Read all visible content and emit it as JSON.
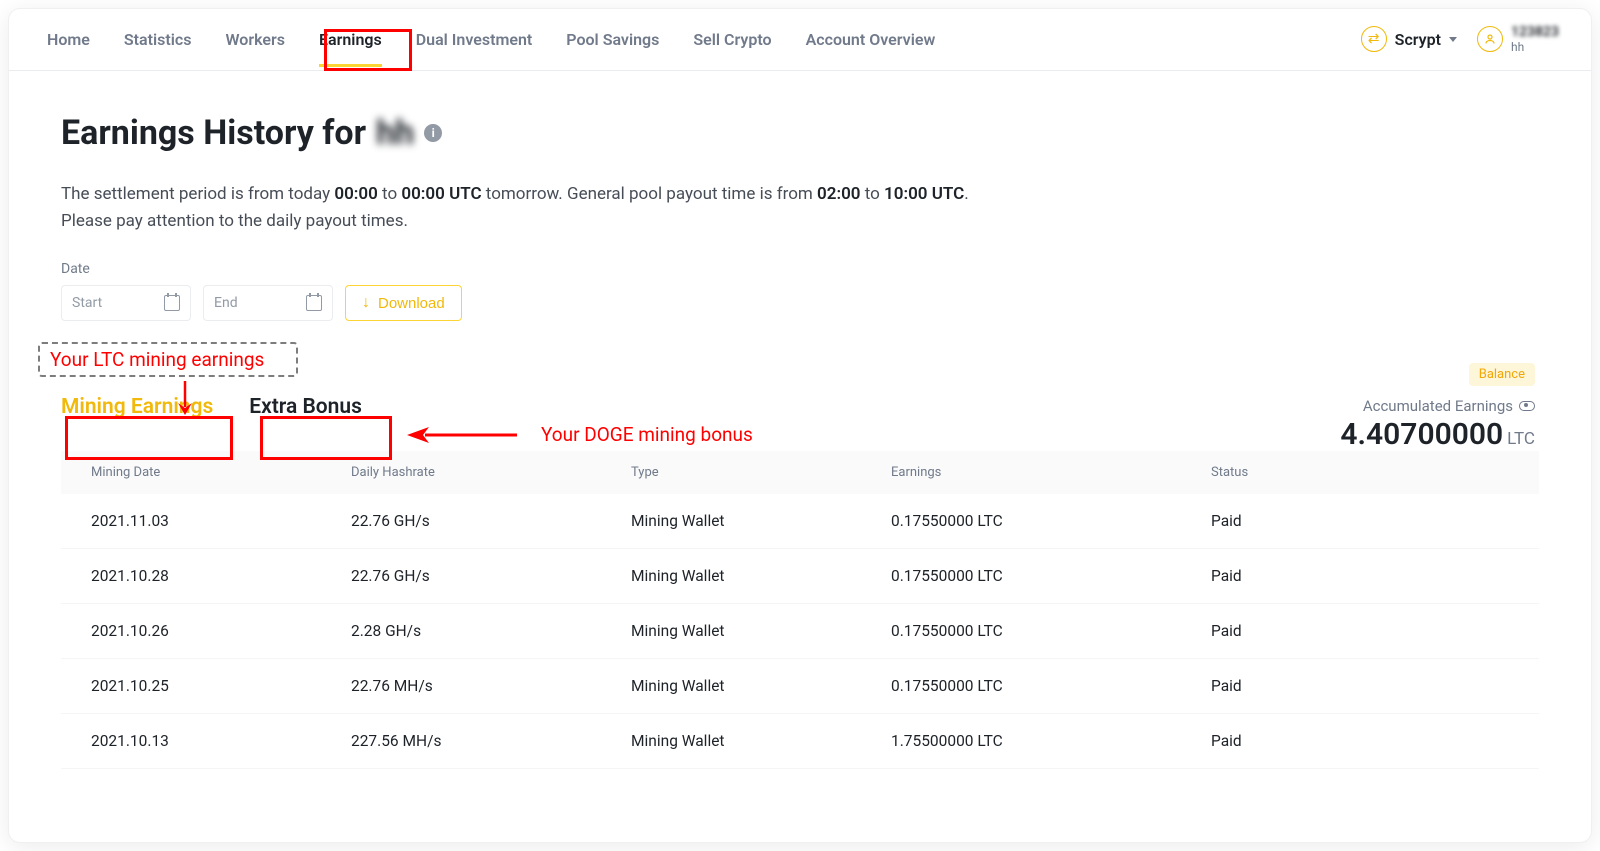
{
  "nav": {
    "items": [
      "Home",
      "Statistics",
      "Workers",
      "Earnings",
      "Dual Investment",
      "Pool Savings",
      "Sell Crypto",
      "Account Overview"
    ],
    "active_index": 3
  },
  "nav_right": {
    "algo_label": "Scrypt",
    "user_top": "123823",
    "user_bot": "hh"
  },
  "header": {
    "title_prefix": "Earnings History for ",
    "title_blur": "hh"
  },
  "desc": {
    "line1_a": "The settlement period is from today ",
    "line1_b": "00:00",
    "line1_c": " to ",
    "line1_d": "00:00 UTC",
    "line1_e": " tomorrow. General pool payout time is from ",
    "line1_f": "02:00",
    "line1_g": " to ",
    "line1_h": "10:00 UTC",
    "line1_i": ".",
    "line2": "Please pay attention to the daily payout times."
  },
  "date": {
    "label": "Date",
    "start_placeholder": "Start",
    "end_placeholder": "End",
    "download_label": "Download"
  },
  "annotations": {
    "ltc_callout": "Your LTC mining earnings",
    "doge_callout": "Your DOGE mining bonus"
  },
  "tabs": {
    "mining_earnings": "Mining Earnings",
    "extra_bonus": "Extra Bonus"
  },
  "balance_tag": "Balance",
  "accum": {
    "label": "Accumulated Earnings",
    "value": "4.40700000",
    "currency": "LTC"
  },
  "table": {
    "columns": [
      "Mining Date",
      "Daily Hashrate",
      "Type",
      "Earnings",
      "Status"
    ],
    "rows": [
      {
        "date": "2021.11.03",
        "hash": "22.76 GH/s",
        "type": "Mining Wallet",
        "earn": "0.17550000 LTC",
        "status": "Paid"
      },
      {
        "date": "2021.10.28",
        "hash": "22.76 GH/s",
        "type": "Mining Wallet",
        "earn": "0.17550000 LTC",
        "status": "Paid"
      },
      {
        "date": "2021.10.26",
        "hash": "2.28 GH/s",
        "type": "Mining Wallet",
        "earn": "0.17550000 LTC",
        "status": "Paid"
      },
      {
        "date": "2021.10.25",
        "hash": "22.76 MH/s",
        "type": "Mining Wallet",
        "earn": "0.17550000 LTC",
        "status": "Paid"
      },
      {
        "date": "2021.10.13",
        "hash": "227.56 MH/s",
        "type": "Mining Wallet",
        "earn": "1.75500000 LTC",
        "status": "Paid"
      }
    ]
  }
}
